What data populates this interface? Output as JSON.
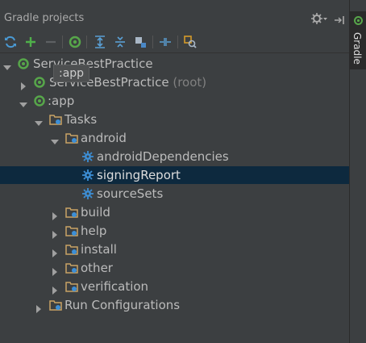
{
  "panel": {
    "title": "Gradle projects"
  },
  "side": {
    "label": "Gradle"
  },
  "tooltip": {
    "text": ":app"
  },
  "toolbar": {
    "icons": [
      "refresh-icon",
      "add-icon",
      "remove-icon",
      "gradle-run-icon",
      "expand-all-icon",
      "collapse-all-icon",
      "toggle-view-icon",
      "link-icon",
      "settings-wrench-icon"
    ]
  },
  "tree": {
    "root": {
      "label": "ServiceBestPractice"
    },
    "root_child": {
      "label": "ServiceBestPractice",
      "suffix": "(root)"
    },
    "app": {
      "label": ":app"
    },
    "tasks": {
      "label": "Tasks"
    },
    "android": {
      "label": "android"
    },
    "android_deps": {
      "label": "androidDependencies"
    },
    "signing_report": {
      "label": "signingReport"
    },
    "source_sets": {
      "label": "sourceSets"
    },
    "build": {
      "label": "build"
    },
    "help": {
      "label": "help"
    },
    "install": {
      "label": "install"
    },
    "other": {
      "label": "other"
    },
    "verification": {
      "label": "verification"
    },
    "run_configs": {
      "label": "Run Configurations"
    }
  },
  "colors": {
    "background": "#3c3f41",
    "selection": "#0d293e",
    "gradle_green": "#57a64a",
    "folder": "#c9a465",
    "task_blue": "#3d8fd6"
  }
}
